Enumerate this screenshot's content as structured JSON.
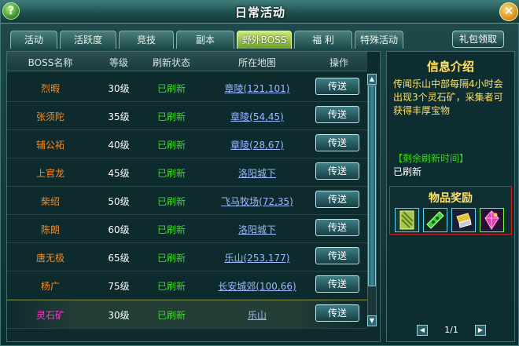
{
  "window": {
    "title": "日常活动"
  },
  "tabs": [
    {
      "label": "活动",
      "active": false
    },
    {
      "label": "活跃度",
      "active": false
    },
    {
      "label": "竞技",
      "active": false
    },
    {
      "label": "副本",
      "active": false
    },
    {
      "label": "野外BOSS",
      "active": true
    },
    {
      "label": "福 利",
      "active": false
    },
    {
      "label": "特殊活动",
      "active": false
    }
  ],
  "gift_button": "礼包领取",
  "table": {
    "headers": [
      "BOSS名称",
      "等级",
      "刷新状态",
      "所在地图",
      "操作"
    ],
    "rows": [
      {
        "name": "烈暇",
        "level": "30级",
        "status": "已刷新",
        "map": "章陵(121,101)",
        "op": "传送"
      },
      {
        "name": "张须陀",
        "level": "35级",
        "status": "已刷新",
        "map": "章陵(54,45)",
        "op": "传送"
      },
      {
        "name": "辅公祏",
        "level": "40级",
        "status": "已刷新",
        "map": "章陵(28,67)",
        "op": "传送"
      },
      {
        "name": "上官龙",
        "level": "45级",
        "status": "已刷新",
        "map": "洛阳城下",
        "op": "传送"
      },
      {
        "name": "柴绍",
        "level": "50级",
        "status": "已刷新",
        "map": "飞马牧场(72,35)",
        "op": "传送"
      },
      {
        "name": "陈朗",
        "level": "60级",
        "status": "已刷新",
        "map": "洛阳城下",
        "op": "传送"
      },
      {
        "name": "唐无极",
        "level": "65级",
        "status": "已刷新",
        "map": "乐山(253,177)",
        "op": "传送"
      },
      {
        "name": "杨广",
        "level": "75级",
        "status": "已刷新",
        "map": "长安城郊(100,66)",
        "op": "传送"
      },
      {
        "name": "灵石矿",
        "level": "30级",
        "status": "已刷新",
        "map": "乐山",
        "op": "传送"
      }
    ]
  },
  "info": {
    "title": "信息介绍",
    "text": "传闻乐山中部每隔4小时会出现3个灵石矿，采集者可获得丰厚宝物",
    "refresh_label": "【剩余刷新时间】",
    "refresh_value": "已刷新"
  },
  "reward": {
    "title": "物品奖励",
    "items": [
      "jade-scroll-icon",
      "green-gem-bar-icon",
      "gold-scroll-icon",
      "pink-crystal-icon"
    ]
  },
  "pager": {
    "text": "1/1",
    "prev": "◀",
    "next": "▶"
  },
  "colors": {
    "accent": "#ffe36a",
    "status_green": "#42d62c",
    "boss_name": "#ff8a1e",
    "special_name": "#ff3ad0",
    "link": "#9fb9ff"
  }
}
